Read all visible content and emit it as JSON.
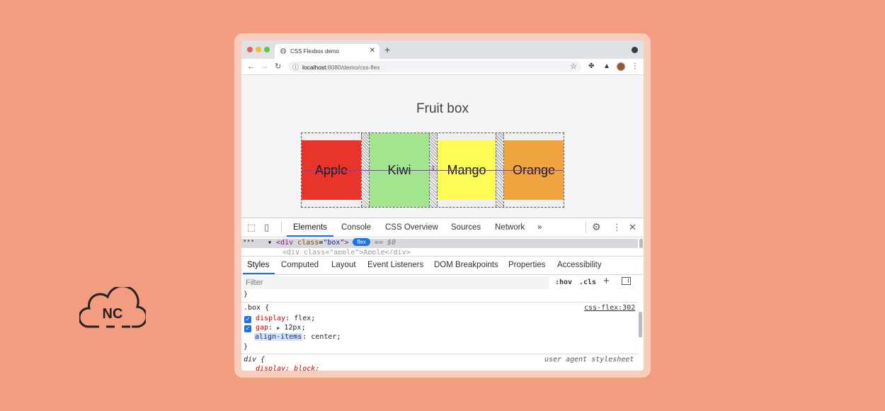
{
  "background": "#f39c7f",
  "logo": {
    "text": "NC",
    "icon": "cloud-icon"
  },
  "browser": {
    "tab_title": "CSS Flexbox demo",
    "url_host": "localhost",
    "url_path": ":8080/demo/css-flex"
  },
  "page": {
    "title": "Fruit box",
    "items": [
      {
        "label": "Apple",
        "color": "#e8342a"
      },
      {
        "label": "Kiwi",
        "color": "#a3e58f"
      },
      {
        "label": "Mango",
        "color": "#fdfc56"
      },
      {
        "label": "Orange",
        "color": "#f0a43e"
      }
    ]
  },
  "devtools": {
    "tabs": [
      "Elements",
      "Console",
      "CSS Overview",
      "Sources",
      "Network"
    ],
    "more_tabs": "»",
    "dom": {
      "dots": "•••",
      "tag_open": "<div",
      "attr_name": "class",
      "attr_value": "\"box\"",
      "tag_close": ">",
      "badge": "flex",
      "eq": "== $0",
      "row2": "<div class=\"apple\">Apple</div>"
    },
    "style_tabs": [
      "Styles",
      "Computed",
      "Layout",
      "Event Listeners",
      "DOM Breakpoints",
      "Properties",
      "Accessibility"
    ],
    "filter_placeholder": "Filter",
    "hov": ":hov",
    "cls": ".cls",
    "rules": {
      "prev_close": "}",
      "selector": ".box {",
      "source": "css-flex:302",
      "display_prop": "display",
      "display_val": "flex;",
      "gap_prop": "gap",
      "gap_val": "12px;",
      "align_prop": "align-items",
      "align_val": "center;",
      "close": "}",
      "ua_selector": "div {",
      "ua_label": "user agent stylesheet",
      "ua_decl": "display: block;"
    }
  }
}
